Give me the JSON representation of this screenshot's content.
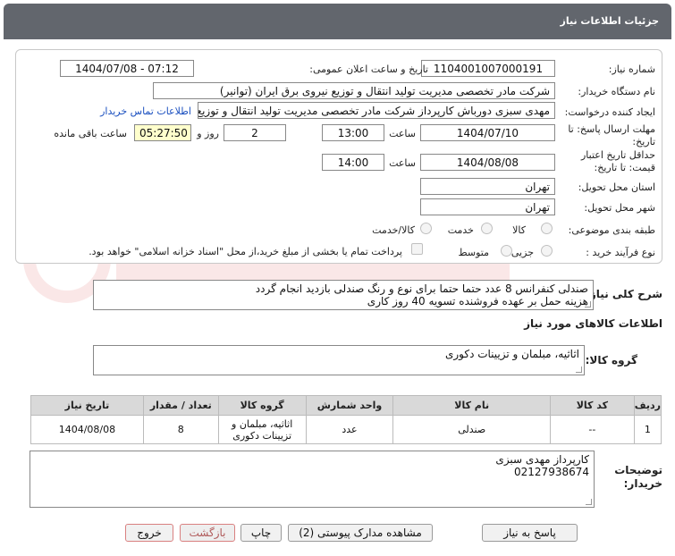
{
  "header": {
    "title": "جزئیات اطلاعات نیاز"
  },
  "form": {
    "need_number": {
      "label": "شماره نیاز:",
      "value": "1104001007000191"
    },
    "announce_datetime": {
      "label": "تاریخ و ساعت اعلان عمومی:",
      "value": "1404/07/08 - 07:12"
    },
    "buyer_org": {
      "label": "نام دستگاه خریدار:",
      "value": "شرکت مادر تخصصی مدیریت تولید  انتقال و توزیع نیروی برق ایران (توانیر)"
    },
    "requester": {
      "label": "ایجاد کننده درخواست:",
      "value": "مهدی سبزی دورباش کارپرداز شرکت مادر تخصصی مدیریت تولید  انتقال و توزیع ن"
    },
    "contact_link": "اطلاعات تماس خریدار",
    "deadline": {
      "label_line1": "مهلت ارسال پاسخ: تا",
      "label_line2": "تاریخ:",
      "date": "1404/07/10",
      "time_label": "ساعت",
      "time": "13:00",
      "days": "2",
      "days_label": "روز و",
      "remaining": "05:27:50",
      "remaining_label": "ساعت باقی مانده"
    },
    "min_price_validity": {
      "label_line1": "حداقل تاریخ اعتبار",
      "label_line2": "قیمت: تا تاریخ:",
      "date": "1404/08/08",
      "time_label": "ساعت",
      "time": "14:00"
    },
    "delivery_province": {
      "label": "استان محل تحویل:",
      "value": "تهران"
    },
    "delivery_city": {
      "label": "شهر محل تحویل:",
      "value": "تهران"
    },
    "category": {
      "label": "طبقه بندی موضوعی:",
      "options": [
        "کالا",
        "خدمت",
        "کالا/خدمت"
      ]
    },
    "purchase_process": {
      "label": "نوع فرآیند خرید :",
      "options": [
        "جزیی",
        "متوسط"
      ],
      "payment_note": "پرداخت تمام یا بخشی از مبلغ خرید،از محل \"اسناد خزانه اسلامی\" خواهد بود."
    }
  },
  "overall": {
    "label": "شرح کلی نیاز:",
    "line1": "صندلی کنفرانس 8 عدد حتما حتما برای نوع و رنگ صندلی بازدید انجام گردد",
    "line2": "هزینه حمل بر عهده فروشنده تسویه 40 روز کاری"
  },
  "goods_info": {
    "title": "اطلاعات کالاهای مورد نیاز"
  },
  "goods_group": {
    "label": "گروه کالا:",
    "value": "اثاثیه، مبلمان و تزیینات دکوری"
  },
  "table": {
    "headers": [
      "ردیف",
      "کد کالا",
      "نام کالا",
      "واحد شمارش",
      "گروه کالا",
      "تعداد / مقدار",
      "تاریخ نیاز"
    ],
    "rows": [
      {
        "row": "1",
        "code": "--",
        "name": "صندلی",
        "unit": "عدد",
        "group_l1": "اثاثیه، مبلمان و",
        "group_l2": "تزیینات دکوری",
        "qty": "8",
        "date": "1404/08/08"
      }
    ]
  },
  "buyer_notes": {
    "label_line1": "توضیحات",
    "label_line2": "خریدار:",
    "line1": "کارپرداز مهدی سبزی",
    "line2": "02127938674"
  },
  "buttons": {
    "reply": "پاسخ به نیاز",
    "attachments": "مشاهده مدارک پیوستی (2)",
    "print": "چاپ",
    "back": "بازگشت",
    "exit": "خروج"
  },
  "colors": {
    "header_bg": "#62666d",
    "link": "#1a4fbf",
    "remaining_bg": "#ffffcc",
    "table_header_bg": "#d9d9d9"
  }
}
